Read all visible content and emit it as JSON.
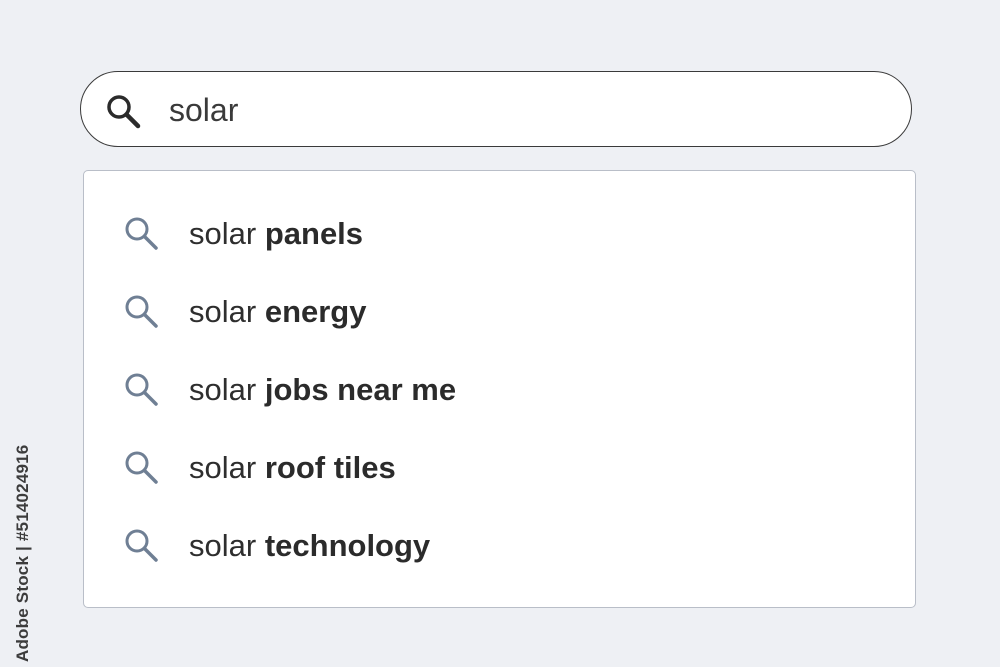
{
  "search": {
    "query": "solar"
  },
  "suggestions": [
    {
      "prefix": "solar",
      "completion": "panels",
      "icon": "search-icon"
    },
    {
      "prefix": "solar",
      "completion": "energy",
      "icon": "search-icon"
    },
    {
      "prefix": "solar",
      "completion": "jobs near me",
      "icon": "search-icon"
    },
    {
      "prefix": "solar",
      "completion": "roof tiles",
      "icon": "search-icon"
    },
    {
      "prefix": "solar",
      "completion": "technology",
      "icon": "search-icon"
    }
  ],
  "watermark": {
    "stock_id": "Adobe Stock | #514024916"
  },
  "colors": {
    "background": "#eef0f4",
    "search_icon_main": "#2b2b2b",
    "suggestion_icon": "#6f7f94",
    "text": "#2b2b2b"
  }
}
